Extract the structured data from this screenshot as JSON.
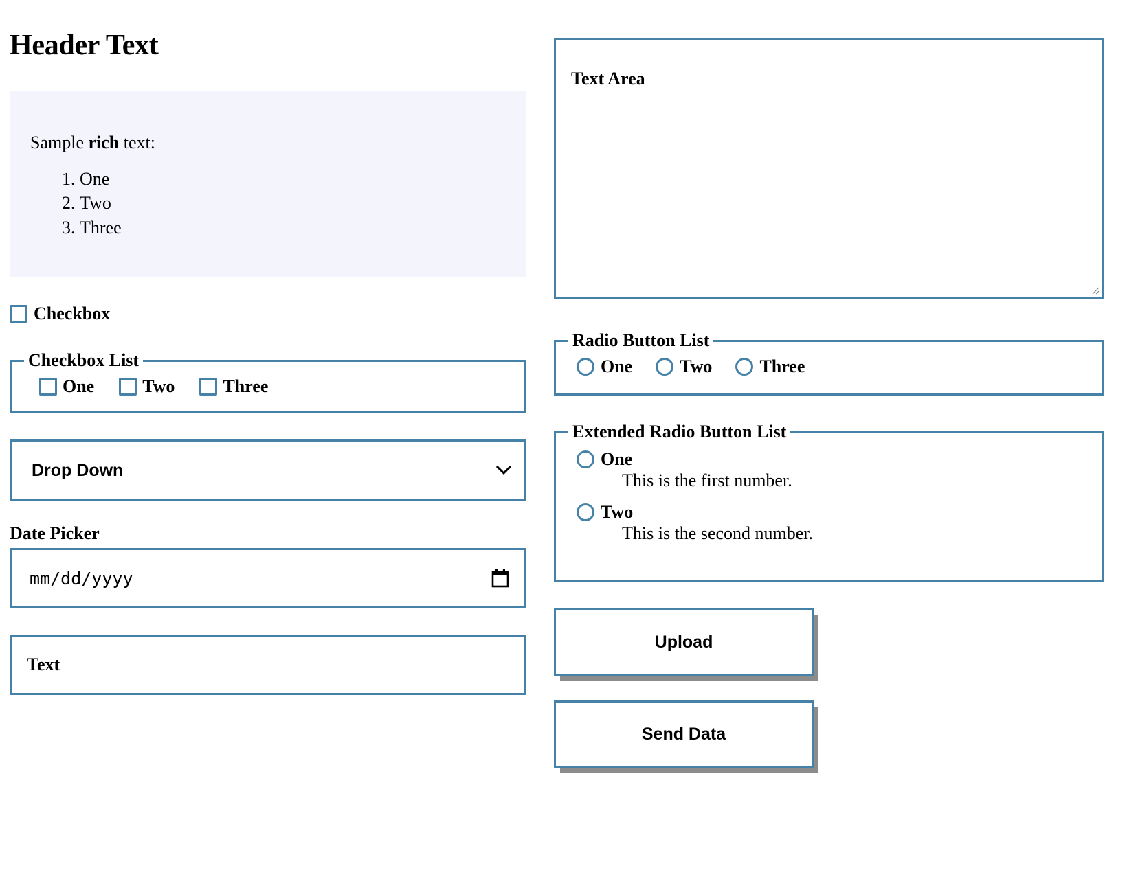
{
  "header": {
    "title": "Header Text"
  },
  "rich_text": {
    "intro_prefix": "Sample ",
    "intro_bold": "rich",
    "intro_suffix": " text:",
    "list_items": [
      "One",
      "Two",
      "Three"
    ],
    "background_color": "#f4f4fc"
  },
  "checkbox": {
    "label": "Checkbox"
  },
  "checkbox_list": {
    "legend": "Checkbox List",
    "items": [
      {
        "label": "One"
      },
      {
        "label": "Two"
      },
      {
        "label": "Three"
      }
    ]
  },
  "drop_down": {
    "selected": "Drop Down",
    "chevron_icon": "chevron-down-icon"
  },
  "date_picker": {
    "label": "Date Picker",
    "placeholder": "mm/dd/yyyy",
    "calendar_icon": "calendar-icon"
  },
  "text_input": {
    "value": "Text"
  },
  "text_area": {
    "label": "Text Area",
    "value": "",
    "resize_handle": "resize-grip-icon"
  },
  "radio_button_list": {
    "legend": "Radio Button List",
    "items": [
      {
        "label": "One"
      },
      {
        "label": "Two"
      },
      {
        "label": "Three"
      }
    ]
  },
  "extended_radio_button_list": {
    "legend": "Extended Radio Button List",
    "items": [
      {
        "label": "One",
        "description": "This is the first number."
      },
      {
        "label": "Two",
        "description": "This is the second number."
      }
    ]
  },
  "buttons": {
    "upload_label": "Upload",
    "send_data_label": "Send Data"
  },
  "theme": {
    "accent_border": "#4682a8",
    "panel_background": "#f4f4fc",
    "shadow_color": "#787878",
    "page_background": "#ffffff",
    "text_color": "#000000"
  }
}
